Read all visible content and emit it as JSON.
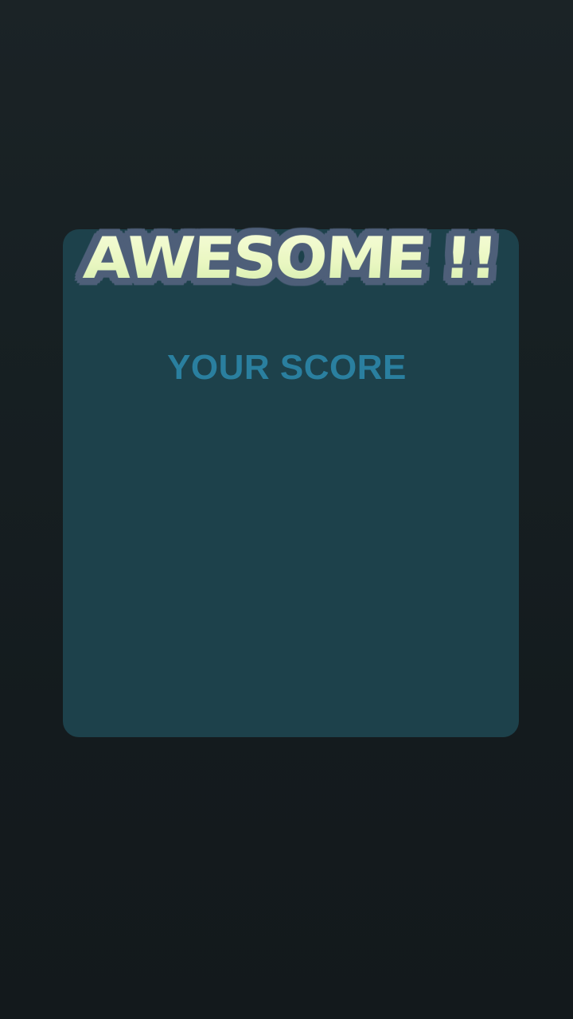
{
  "result": {
    "banner_text": "AWESOME !!",
    "score_label": "YOUR SCORE"
  },
  "colors": {
    "background": "#161e21",
    "panel": "#1d414b",
    "banner_fill": "#eef9c6",
    "banner_outline": "#4e5f79",
    "score_label": "#2a7f9f"
  }
}
